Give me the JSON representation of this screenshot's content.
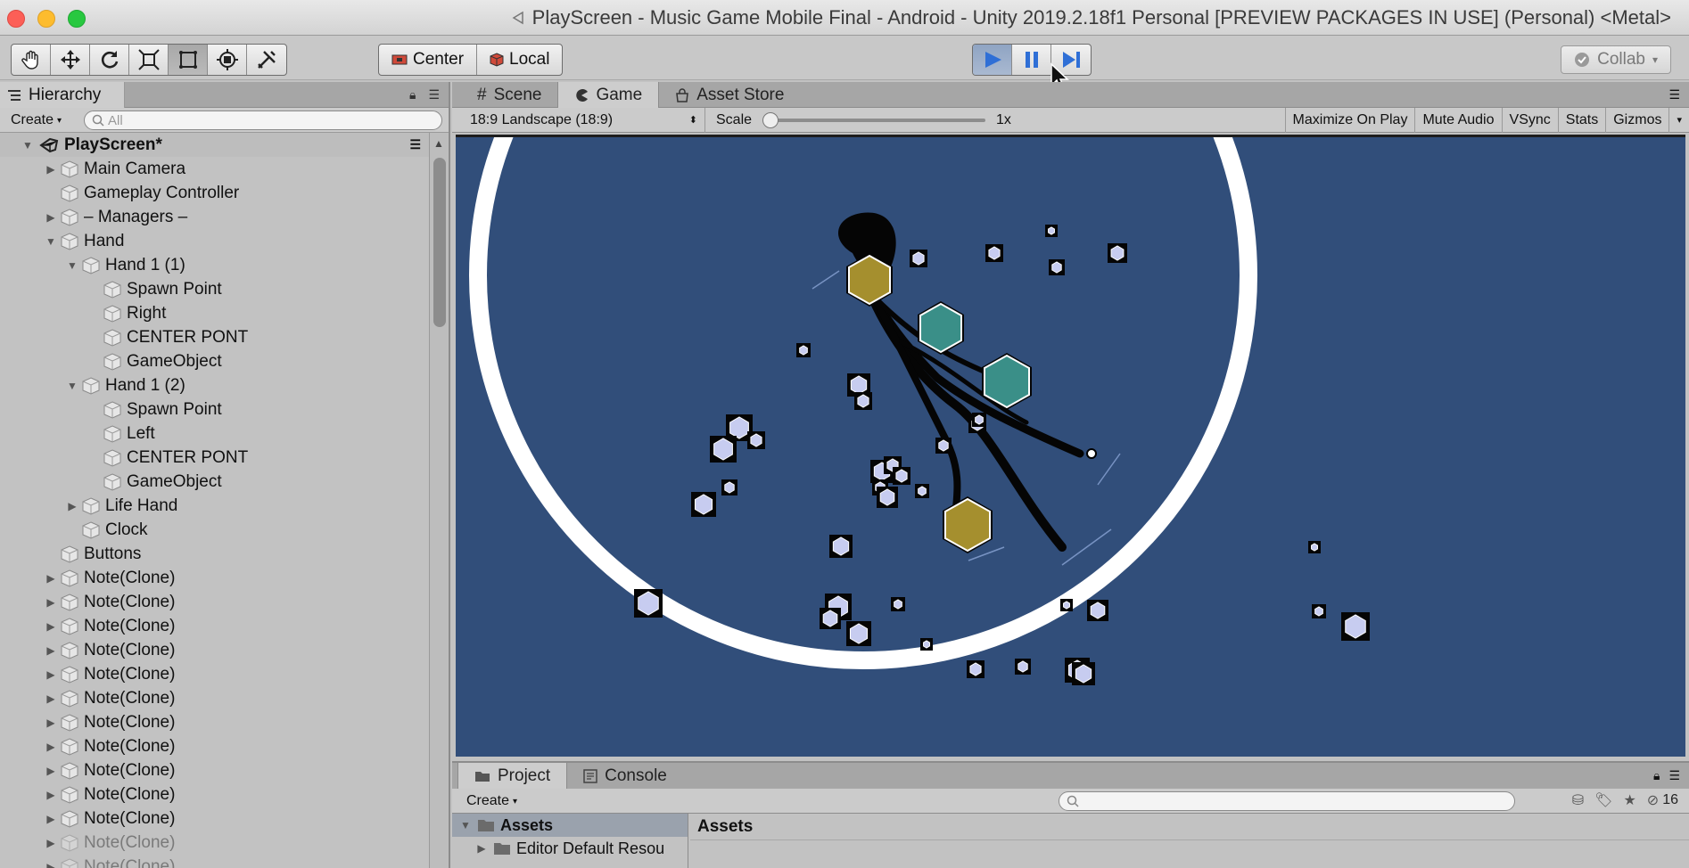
{
  "window": {
    "title": "PlayScreen - Music Game Mobile Final - Android - Unity 2019.2.18f1 Personal [PREVIEW PACKAGES IN USE] (Personal) <Metal>"
  },
  "toolbar": {
    "tools": [
      "hand-tool",
      "move-tool",
      "rotate-tool",
      "scale-tool",
      "rect-tool",
      "transform-tool",
      "custom-tool"
    ],
    "pivot_label": "Center",
    "space_label": "Local",
    "collab_label": "Collab"
  },
  "hierarchy": {
    "tab_label": "Hierarchy",
    "create_label": "Create",
    "search_placeholder": "All",
    "scene_name": "PlayScreen*",
    "items": [
      {
        "label": "Main Camera",
        "depth": 1,
        "arrow": "right"
      },
      {
        "label": "Gameplay Controller",
        "depth": 1,
        "arrow": ""
      },
      {
        "label": "– Managers –",
        "depth": 1,
        "arrow": "right"
      },
      {
        "label": "Hand",
        "depth": 1,
        "arrow": "down"
      },
      {
        "label": "Hand 1 (1)",
        "depth": 2,
        "arrow": "down"
      },
      {
        "label": "Spawn Point",
        "depth": 3,
        "arrow": ""
      },
      {
        "label": "Right",
        "depth": 3,
        "arrow": ""
      },
      {
        "label": "CENTER PONT",
        "depth": 3,
        "arrow": ""
      },
      {
        "label": "GameObject",
        "depth": 3,
        "arrow": ""
      },
      {
        "label": "Hand 1 (2)",
        "depth": 2,
        "arrow": "down"
      },
      {
        "label": "Spawn Point",
        "depth": 3,
        "arrow": ""
      },
      {
        "label": "Left",
        "depth": 3,
        "arrow": ""
      },
      {
        "label": "CENTER PONT",
        "depth": 3,
        "arrow": ""
      },
      {
        "label": "GameObject",
        "depth": 3,
        "arrow": ""
      },
      {
        "label": "Life Hand",
        "depth": 2,
        "arrow": "right"
      },
      {
        "label": "Clock",
        "depth": 2,
        "arrow": ""
      },
      {
        "label": "Buttons",
        "depth": 1,
        "arrow": ""
      },
      {
        "label": "Note(Clone)",
        "depth": 1,
        "arrow": "right"
      },
      {
        "label": "Note(Clone)",
        "depth": 1,
        "arrow": "right"
      },
      {
        "label": "Note(Clone)",
        "depth": 1,
        "arrow": "right"
      },
      {
        "label": "Note(Clone)",
        "depth": 1,
        "arrow": "right"
      },
      {
        "label": "Note(Clone)",
        "depth": 1,
        "arrow": "right"
      },
      {
        "label": "Note(Clone)",
        "depth": 1,
        "arrow": "right"
      },
      {
        "label": "Note(Clone)",
        "depth": 1,
        "arrow": "right"
      },
      {
        "label": "Note(Clone)",
        "depth": 1,
        "arrow": "right"
      },
      {
        "label": "Note(Clone)",
        "depth": 1,
        "arrow": "right"
      },
      {
        "label": "Note(Clone)",
        "depth": 1,
        "arrow": "right"
      },
      {
        "label": "Note(Clone)",
        "depth": 1,
        "arrow": "right"
      },
      {
        "label": "Note(Clone)",
        "depth": 1,
        "arrow": "right",
        "dim": true
      },
      {
        "label": "Note(Clone)",
        "depth": 1,
        "arrow": "right",
        "dim": true
      }
    ]
  },
  "game_panel": {
    "tabs": [
      {
        "label": "Scene",
        "icon": "grid-icon",
        "active": false
      },
      {
        "label": "Game",
        "icon": "pacman-icon",
        "active": true
      },
      {
        "label": "Asset Store",
        "icon": "store-icon",
        "active": false
      }
    ],
    "resolution": "18:9 Landscape (18:9)",
    "scale_label": "Scale",
    "scale_value": "1x",
    "buttons": [
      "Maximize On Play",
      "Mute Audio",
      "VSync",
      "Stats",
      "Gizmos"
    ]
  },
  "project_panel": {
    "tabs": [
      {
        "label": "Project",
        "icon": "folder-icon",
        "active": true
      },
      {
        "label": "Console",
        "icon": "console-icon",
        "active": false
      }
    ],
    "create_label": "Create",
    "hidden_count": "16",
    "tree": [
      {
        "label": "Assets",
        "selected": true
      },
      {
        "label": "Editor Default Resou",
        "selected": false
      }
    ],
    "breadcrumb": "Assets"
  },
  "colors": {
    "game_background": "#314e7a",
    "gold_note": "#a58f2e",
    "teal_note": "#3a8f88",
    "small_note": "#c7ccf0",
    "play_blue": "#2f6fd6"
  }
}
